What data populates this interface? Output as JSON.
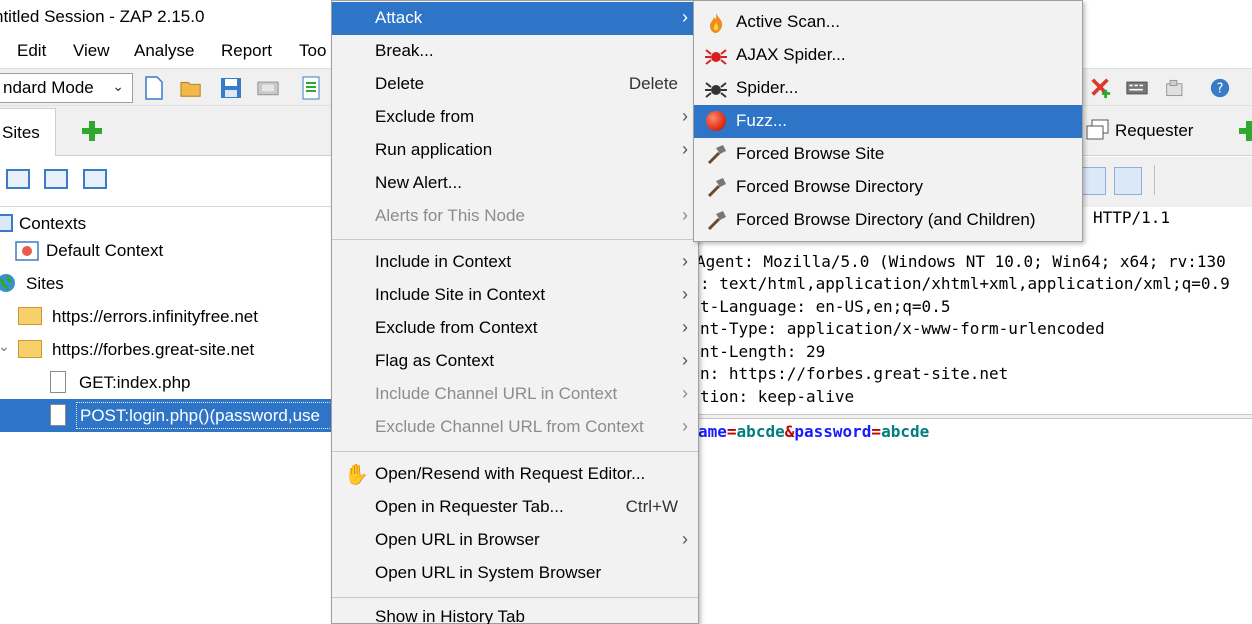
{
  "window": {
    "title": "ntitled Session - ZAP 2.15.0"
  },
  "menubar": {
    "items": [
      "Edit",
      "View",
      "Analyse",
      "Report",
      "Too"
    ]
  },
  "toolbar": {
    "mode_value": "ndard Mode"
  },
  "sites_panel": {
    "tab_label": "Sites",
    "tree": {
      "contexts_label": "Contexts",
      "default_context_label": "Default Context",
      "sites_label": "Sites",
      "site1": "https://errors.infinityfree.net",
      "site2": "https://forbes.great-site.net",
      "node_get": "GET:index.php",
      "node_post": "POST:login.php()(password,use"
    }
  },
  "right_panel": {
    "requester_tab": "Requester",
    "request_lines": [
      "HTTP/1.1",
      "Agent: Mozilla/5.0 (Windows NT 10.0; Win64; x64; rv:130",
      ": text/html,application/xhtml+xml,application/xml;q=0.9",
      "t-Language: en-US,en;q=0.5",
      "nt-Type: application/x-www-form-urlencoded",
      "nt-Length: 29",
      "n: https://forbes.great-site.net",
      "tion: keep-alive"
    ],
    "body": {
      "k1": "ame",
      "eq1": "=",
      "v1": "abcde",
      "amp": "&",
      "k2": "password",
      "eq2": "=",
      "v2": "abcde"
    }
  },
  "context_menu": {
    "attack": "Attack",
    "break": "Break...",
    "delete": "Delete",
    "delete_accel": "Delete",
    "exclude_from": "Exclude from",
    "run_application": "Run application",
    "new_alert": "New Alert...",
    "alerts_for_node": "Alerts for This Node",
    "include_in_context": "Include in Context",
    "include_site_in_context": "Include Site in Context",
    "exclude_from_context": "Exclude from Context",
    "flag_as_context": "Flag as Context",
    "include_channel_url": "Include Channel URL in Context",
    "exclude_channel_url": "Exclude Channel URL from Context",
    "open_resend": "Open/Resend with Request Editor...",
    "open_requester_tab": "Open in Requester Tab...",
    "open_requester_accel": "Ctrl+W",
    "open_url_browser": "Open URL in Browser",
    "open_url_system_browser": "Open URL in System Browser",
    "show_history_tab": "Show in History Tab"
  },
  "attack_submenu": {
    "active_scan": "Active Scan...",
    "ajax_spider": "AJAX Spider...",
    "spider": "Spider...",
    "fuzz": "Fuzz...",
    "forced_browse_site": "Forced Browse Site",
    "forced_browse_directory": "Forced Browse Directory",
    "forced_browse_directory_children": "Forced Browse Directory (and Children)"
  },
  "colors": {
    "highlight": "#2e75c7",
    "menu_background": "#f2f2f2",
    "disabled_text": "#8c8c8c"
  }
}
